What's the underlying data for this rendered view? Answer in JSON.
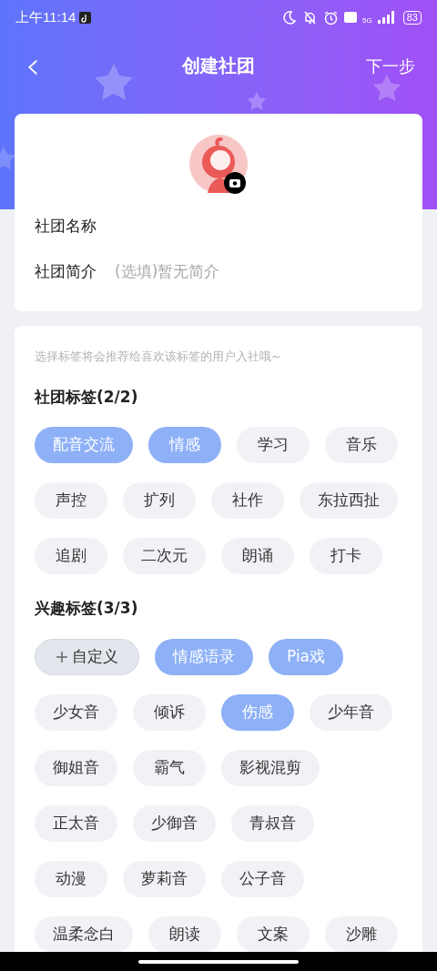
{
  "status_bar": {
    "time": "上午11:14",
    "battery": "83",
    "network": "5G"
  },
  "nav": {
    "back": "‹",
    "title": "创建社团",
    "action": "下一步"
  },
  "profile": {
    "fields": [
      {
        "label": "社团名称"
      },
      {
        "label": "社团简介",
        "placeholder": "(选填)暂无简介"
      }
    ]
  },
  "tags": {
    "hint": "选择标签将会推荐给喜欢该标签的用户入社哦~",
    "groups": [
      {
        "title": "社团标签(2/2)",
        "rows": [
          [
            {
              "kind": "tag",
              "label": "配音交流",
              "selected": true
            },
            {
              "kind": "tag",
              "label": "情感",
              "selected": true
            },
            {
              "kind": "tag",
              "label": "学习",
              "selected": false
            },
            {
              "kind": "tag",
              "label": "音乐",
              "selected": false
            }
          ],
          [
            {
              "kind": "tag",
              "label": "声控",
              "selected": false
            },
            {
              "kind": "tag",
              "label": "扩列",
              "selected": false
            },
            {
              "kind": "tag",
              "label": "社作",
              "selected": false
            },
            {
              "kind": "tag",
              "label": "东拉西扯",
              "selected": false
            }
          ],
          [
            {
              "kind": "tag",
              "label": "追剧",
              "selected": false
            },
            {
              "kind": "tag",
              "label": "二次元",
              "selected": false
            },
            {
              "kind": "tag",
              "label": "朗诵",
              "selected": false
            },
            {
              "kind": "tag",
              "label": "打卡",
              "selected": false
            }
          ]
        ]
      },
      {
        "title": "兴趣标签(3/3)",
        "rows": [
          [
            {
              "kind": "custom",
              "label": "自定义"
            },
            {
              "kind": "tag",
              "label": "情感语录",
              "selected": true
            },
            {
              "kind": "tag",
              "label": "Pia戏",
              "selected": true
            }
          ],
          [
            {
              "kind": "tag",
              "label": "少女音",
              "selected": false
            },
            {
              "kind": "tag",
              "label": "倾诉",
              "selected": false
            },
            {
              "kind": "tag",
              "label": "伤感",
              "selected": true
            },
            {
              "kind": "tag",
              "label": "少年音",
              "selected": false
            }
          ],
          [
            {
              "kind": "tag",
              "label": "御姐音",
              "selected": false
            },
            {
              "kind": "tag",
              "label": "霸气",
              "selected": false
            },
            {
              "kind": "tag",
              "label": "影视混剪",
              "selected": false
            }
          ],
          [
            {
              "kind": "tag",
              "label": "正太音",
              "selected": false
            },
            {
              "kind": "tag",
              "label": "少御音",
              "selected": false
            },
            {
              "kind": "tag",
              "label": "青叔音",
              "selected": false
            }
          ],
          [
            {
              "kind": "tag",
              "label": "动漫",
              "selected": false
            },
            {
              "kind": "tag",
              "label": "萝莉音",
              "selected": false
            },
            {
              "kind": "tag",
              "label": "公子音",
              "selected": false
            }
          ],
          [
            {
              "kind": "tag",
              "label": "温柔念白",
              "selected": false
            },
            {
              "kind": "tag",
              "label": "朗读",
              "selected": false
            },
            {
              "kind": "tag",
              "label": "文案",
              "selected": false
            },
            {
              "kind": "tag",
              "label": "沙雕",
              "selected": false
            }
          ]
        ]
      }
    ]
  }
}
